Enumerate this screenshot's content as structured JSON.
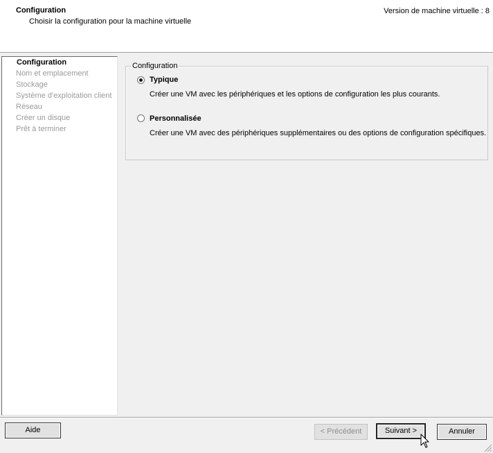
{
  "header": {
    "title": "Configuration",
    "subtitle": "Choisir la configuration pour la machine virtuelle",
    "version": "Version de machine virtuelle : 8"
  },
  "sidebar": {
    "items": [
      {
        "label": "Configuration",
        "active": true
      },
      {
        "label": "Nom et emplacement",
        "active": false
      },
      {
        "label": "Stockage",
        "active": false
      },
      {
        "label": "Système d'exploitation client",
        "active": false
      },
      {
        "label": "Réseau",
        "active": false
      },
      {
        "label": "Créer un disque",
        "active": false
      },
      {
        "label": "Prêt à terminer",
        "active": false
      }
    ]
  },
  "main": {
    "group_title": "Configuration",
    "options": [
      {
        "label": "Typique",
        "description": "Créer une VM avec les périphériques et les options de configuration les plus courants.",
        "selected": true
      },
      {
        "label": "Personnalisée",
        "description": "Créer une VM avec des périphériques supplémentaires ou des options de configuration spécifiques.",
        "selected": false
      }
    ]
  },
  "footer": {
    "help_label": "Aide",
    "back_label": "< Précédent",
    "next_label": "Suivant >",
    "cancel_label": "Annuler"
  },
  "colors": {
    "window_bg": "#f0f0f0",
    "panel_bg": "#ffffff",
    "disabled_text": "#9a9a9a"
  },
  "icons": [
    "radio-button",
    "mouse-cursor-icon",
    "resize-grip-icon"
  ]
}
